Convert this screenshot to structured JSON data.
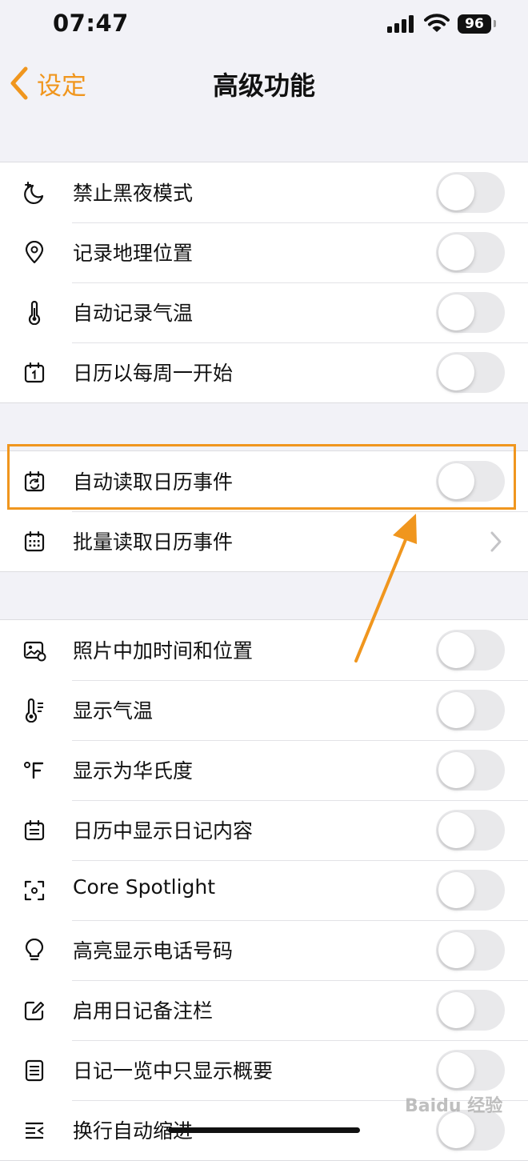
{
  "status_bar": {
    "time": "07:47",
    "battery": "96"
  },
  "nav": {
    "back_label": "设定",
    "title": "高级功能"
  },
  "colors": {
    "accent": "#f0961e",
    "toggle_off": "#e9e9eb",
    "background": "#f2f2f7"
  },
  "groups": [
    {
      "rows": [
        {
          "label": "禁止黑夜模式",
          "icon": "moon-stars-icon",
          "control": "toggle",
          "on": false
        },
        {
          "label": "记录地理位置",
          "icon": "location-pin-icon",
          "control": "toggle",
          "on": false
        },
        {
          "label": "自动记录气温",
          "icon": "thermometer-icon",
          "control": "toggle",
          "on": false
        },
        {
          "label": "日历以每周一开始",
          "icon": "calendar-one-icon",
          "control": "toggle",
          "on": false
        }
      ]
    },
    {
      "rows": [
        {
          "label": "自动读取日历事件",
          "icon": "calendar-sync-icon",
          "control": "toggle",
          "on": false
        },
        {
          "label": "批量读取日历事件",
          "icon": "calendar-grid-icon",
          "control": "chevron"
        }
      ]
    },
    {
      "rows": [
        {
          "label": "照片中加时间和位置",
          "icon": "photo-icon",
          "control": "toggle",
          "on": false
        },
        {
          "label": "显示气温",
          "icon": "thermometer-lines-icon",
          "control": "toggle",
          "on": false
        },
        {
          "label": "显示为华氏度",
          "icon": "fahrenheit-icon",
          "control": "toggle",
          "on": false
        },
        {
          "label": "日历中显示日记内容",
          "icon": "calendar-list-icon",
          "control": "toggle",
          "on": false
        },
        {
          "label": "Core Spotlight",
          "icon": "spotlight-scan-icon",
          "control": "toggle",
          "on": false
        },
        {
          "label": "高亮显示电话号码",
          "icon": "lightbulb-icon",
          "control": "toggle",
          "on": false
        },
        {
          "label": "启用日记备注栏",
          "icon": "edit-note-icon",
          "control": "toggle",
          "on": false
        },
        {
          "label": "日记一览中只显示概要",
          "icon": "document-lines-icon",
          "control": "toggle",
          "on": false
        },
        {
          "label": "换行自动缩进",
          "icon": "indent-icon",
          "control": "toggle",
          "on": false
        }
      ]
    }
  ],
  "watermark": "Baidu 经验"
}
